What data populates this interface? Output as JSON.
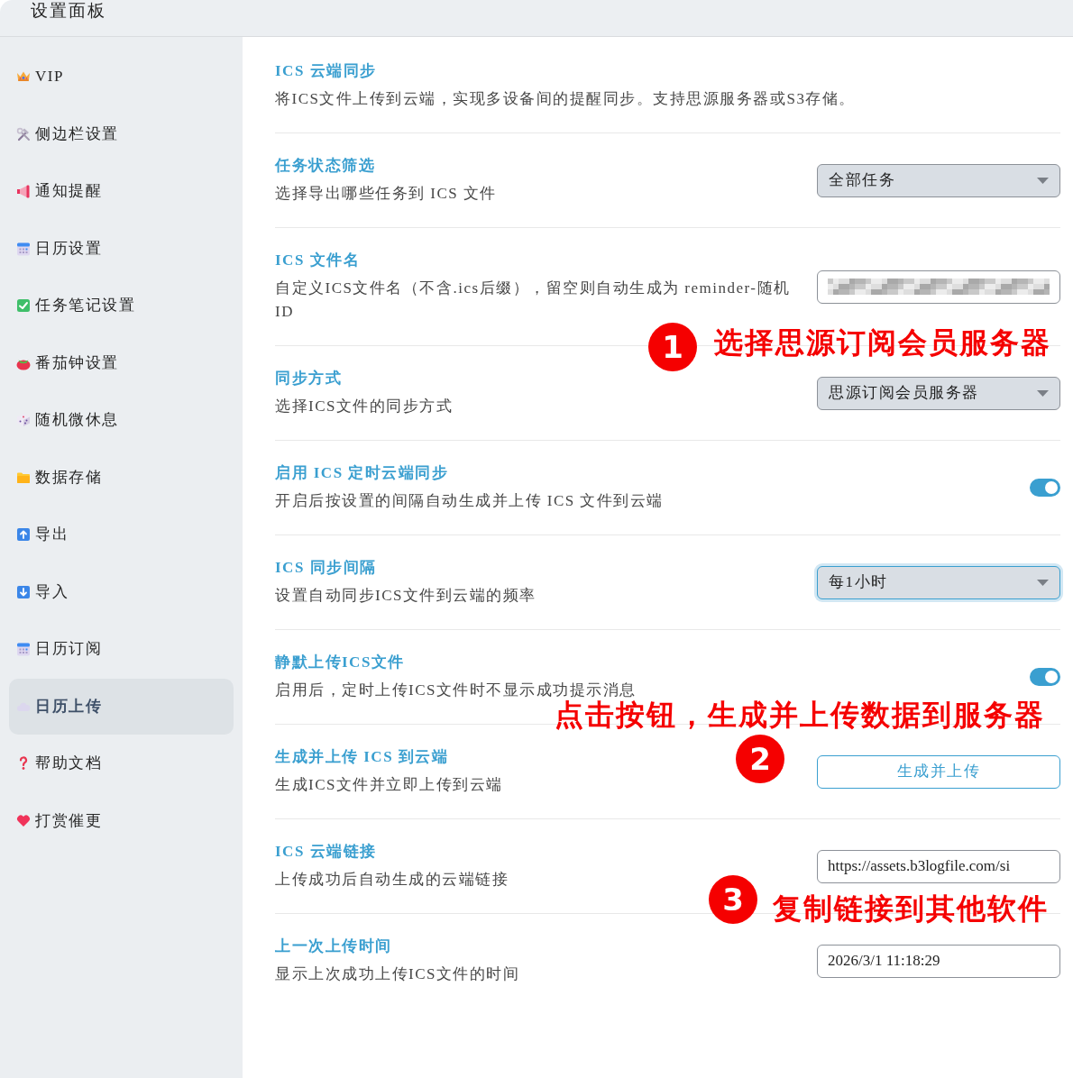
{
  "header": {
    "title": "设置面板"
  },
  "sidebar": {
    "items": [
      {
        "label": "VIP",
        "selected": false
      },
      {
        "label": "侧边栏设置",
        "selected": false
      },
      {
        "label": "通知提醒",
        "selected": false
      },
      {
        "label": "日历设置",
        "selected": false
      },
      {
        "label": "任务笔记设置",
        "selected": false
      },
      {
        "label": "番茄钟设置",
        "selected": false
      },
      {
        "label": "随机微休息",
        "selected": false
      },
      {
        "label": "数据存储",
        "selected": false
      },
      {
        "label": "导出",
        "selected": false
      },
      {
        "label": "导入",
        "selected": false
      },
      {
        "label": "日历订阅",
        "selected": false
      },
      {
        "label": "日历上传",
        "selected": true
      },
      {
        "label": "帮助文档",
        "selected": false
      },
      {
        "label": "打赏催更",
        "selected": false
      }
    ]
  },
  "settings": [
    {
      "kind": "info",
      "title": "ICS 云端同步",
      "description": "将ICS文件上传到云端，实现多设备间的提醒同步。支持思源服务器或S3存储。"
    },
    {
      "kind": "select",
      "title": "任务状态筛选",
      "description": "选择导出哪些任务到 ICS 文件",
      "value": "全部任务",
      "focused": false
    },
    {
      "kind": "input",
      "title": "ICS 文件名",
      "description": "自定义ICS文件名（不含.ics后缀），留空则自动生成为 reminder-随机ID",
      "obscured": true
    },
    {
      "kind": "select",
      "title": "同步方式",
      "description": "选择ICS文件的同步方式",
      "value": "思源订阅会员服务器",
      "focused": false
    },
    {
      "kind": "toggle",
      "title": "启用 ICS 定时云端同步",
      "description": "开启后按设置的间隔自动生成并上传 ICS 文件到云端",
      "on": true
    },
    {
      "kind": "select",
      "title": "ICS 同步间隔",
      "description": "设置自动同步ICS文件到云端的频率",
      "value": "每1小时",
      "focused": true
    },
    {
      "kind": "toggle",
      "title": "静默上传ICS文件",
      "description": "启用后，定时上传ICS文件时不显示成功提示消息",
      "on": true
    },
    {
      "kind": "button",
      "title": "生成并上传 ICS 到云端",
      "description": "生成ICS文件并立即上传到云端",
      "button": "生成并上传"
    },
    {
      "kind": "input",
      "title": "ICS 云端链接",
      "description": "上传成功后自动生成的云端链接",
      "value": "https://assets.b3logfile.com/si"
    },
    {
      "kind": "input",
      "title": "上一次上传时间",
      "description": "显示上次成功上传ICS文件的时间",
      "value": "2026/3/1 11:18:29"
    }
  ],
  "annotations": [
    {
      "number": "1",
      "text": "选择思源订阅会员服务器"
    },
    {
      "number": "2",
      "text": "点击按钮，生成并上传数据到服务器"
    },
    {
      "number": "3",
      "text": "复制链接到其他软件"
    }
  ]
}
